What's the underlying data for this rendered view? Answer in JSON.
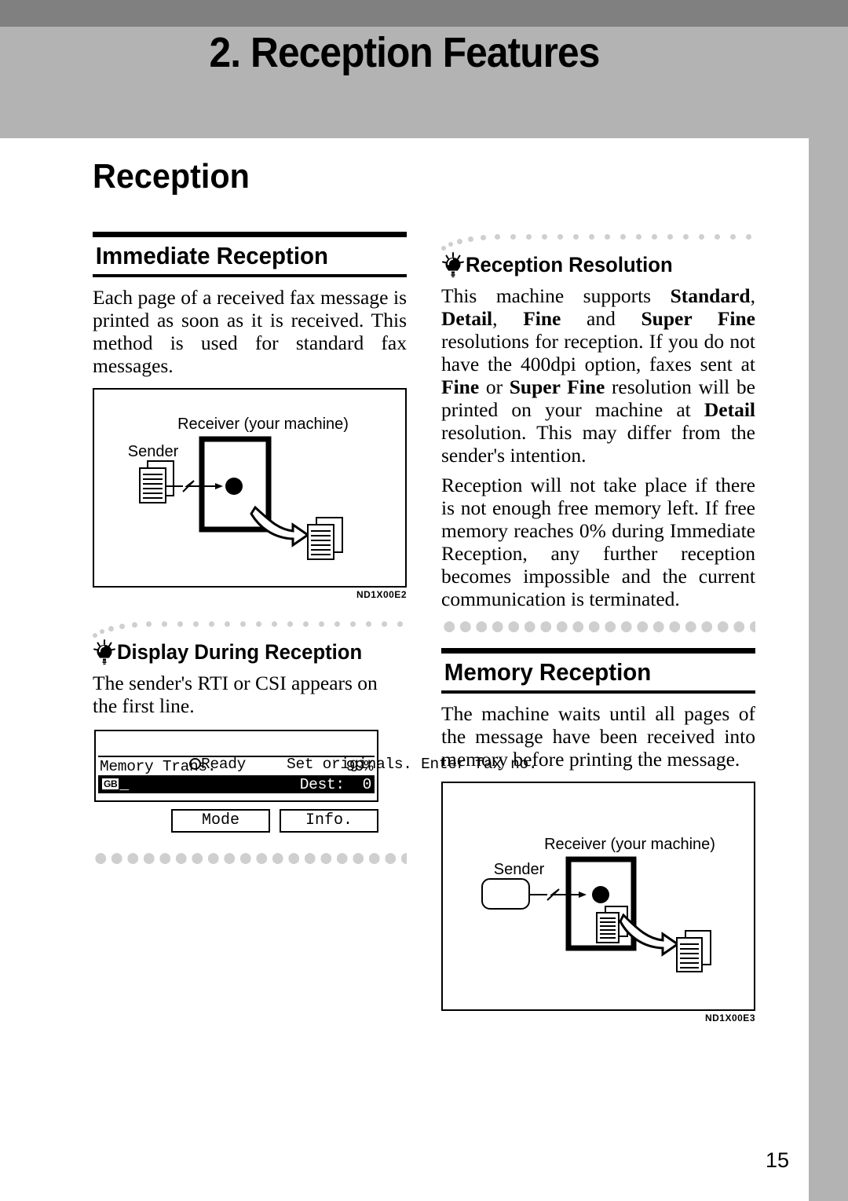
{
  "chapter": {
    "title": "2. Reception Features"
  },
  "page": {
    "title": "Reception",
    "number": "15"
  },
  "left_column": {
    "section1": {
      "heading": "Immediate Reception",
      "paragraph": "Each page of a received fax message is printed as soon as it is received. This method is used for standard fax messages.",
      "figure": {
        "code": "ND1X00E2",
        "sender_label": "Sender",
        "receiver_label": "Receiver (your machine)"
      }
    },
    "tip1": {
      "icon": "lightbulb-icon",
      "heading": "Display During Reception",
      "paragraph": "The sender's RTI or CSI appears on the first line.",
      "lcd": {
        "status_icon": "ready-circle-icon",
        "line1_left": "Ready",
        "line1_right": "Set originals. Enter fax no.",
        "line2_left": "Memory Trans.",
        "line2_right": "99%",
        "line3_icon": "GB",
        "line3_cursor": "_",
        "line3_right": "Dest:  0",
        "softkey_mode": "Mode",
        "softkey_info": "Info."
      }
    }
  },
  "right_column": {
    "tip2": {
      "icon": "lightbulb-icon",
      "heading": "Reception Resolution",
      "paragraph1_parts": [
        {
          "text": "This machine supports ",
          "bold": false
        },
        {
          "text": "Standard",
          "bold": true
        },
        {
          "text": ", ",
          "bold": false
        },
        {
          "text": "Detail",
          "bold": true
        },
        {
          "text": ", ",
          "bold": false
        },
        {
          "text": "Fine",
          "bold": true
        },
        {
          "text": " and  ",
          "bold": false
        },
        {
          "text": "Super Fine",
          "bold": true
        },
        {
          "text": " resolutions for reception. If you do not have the 400dpi option, faxes sent at ",
          "bold": false
        },
        {
          "text": "Fine",
          "bold": true
        },
        {
          "text": " or ",
          "bold": false
        },
        {
          "text": "Super Fine",
          "bold": true
        },
        {
          "text": " resolution will be printed on your machine at ",
          "bold": false
        },
        {
          "text": "Detail",
          "bold": true
        },
        {
          "text": " resolution. This may differ from the sender's intention.",
          "bold": false
        }
      ],
      "paragraph2": "Reception will not take place if there is not enough free memory left. If free memory reaches 0% during Immediate Reception, any further reception becomes impossible and the current communication is terminated."
    },
    "section2": {
      "heading": "Memory Reception",
      "paragraph": "The machine waits until all pages of the message have been received into memory before printing the message.",
      "figure": {
        "code": "ND1X00E3",
        "sender_label": "Sender",
        "receiver_label": "Receiver (your machine)"
      }
    }
  },
  "colors": {
    "band_dark": "#808080",
    "band_light": "#b3b3b3",
    "page": "#ffffff",
    "ink": "#000000",
    "dot": "#cfcfcf"
  }
}
